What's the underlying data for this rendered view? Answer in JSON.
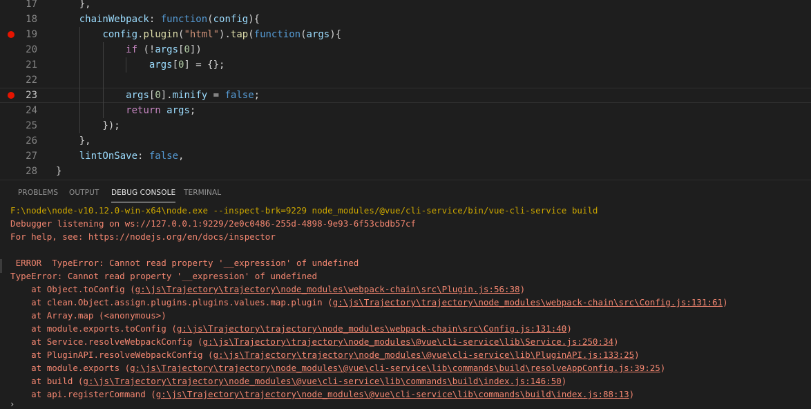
{
  "editor": {
    "lines": [
      {
        "n": "17",
        "code": "    },"
      },
      {
        "n": "18",
        "code": "    chainWebpack: function(config){"
      },
      {
        "n": "19",
        "code": "        config.plugin(\"html\").tap(function(args){",
        "breakpoint": true
      },
      {
        "n": "20",
        "code": "            if (!args[0])"
      },
      {
        "n": "21",
        "code": "                args[0] = {};"
      },
      {
        "n": "22",
        "code": ""
      },
      {
        "n": "23",
        "code": "            args[0].minify = false;",
        "breakpoint": true,
        "current": true
      },
      {
        "n": "24",
        "code": "            return args;"
      },
      {
        "n": "25",
        "code": "        });"
      },
      {
        "n": "26",
        "code": "    },"
      },
      {
        "n": "27",
        "code": "    lintOnSave: false,"
      },
      {
        "n": "28",
        "code": "}"
      }
    ]
  },
  "panel": {
    "tabs": [
      {
        "label": "PROBLEMS",
        "active": false
      },
      {
        "label": "OUTPUT",
        "active": false
      },
      {
        "label": "DEBUG CONSOLE",
        "active": true
      },
      {
        "label": "TERMINAL",
        "active": false
      }
    ],
    "console_lines": [
      {
        "text": "  F:\\node\\node-v10.12.0-win-x64\\node.exe --inspect-brk=9229 node_modules/@vue/cli-service/bin/vue-cli-service build",
        "kind": "cmd"
      },
      {
        "text": "  Debugger listening on ws://127.0.0.1:9229/2e0c0486-255d-4898-9e93-6f53cbdb57cf",
        "kind": "info"
      },
      {
        "text": "  For help, see: https://nodejs.org/en/docs/inspector",
        "kind": "info"
      },
      {
        "text": "",
        "kind": "info"
      },
      {
        "text": "   ERROR  TypeError: Cannot read property '__expression' of undefined",
        "kind": "err"
      },
      {
        "text": "  TypeError: Cannot read property '__expression' of undefined",
        "kind": "err"
      },
      {
        "prefix": "      at Object.toConfig (",
        "path": "g:\\js\\Trajectory\\trajectory\\node_modules\\webpack-chain\\src\\Plugin.js:56:38",
        "suffix": ")",
        "kind": "err"
      },
      {
        "prefix": "      at clean.Object.assign.plugins.plugins.values.map.plugin (",
        "path": "g:\\js\\Trajectory\\trajectory\\node_modules\\webpack-chain\\src\\Config.js:131:61",
        "suffix": ")",
        "kind": "err"
      },
      {
        "text": "      at Array.map (<anonymous>)",
        "kind": "err"
      },
      {
        "prefix": "      at module.exports.toConfig (",
        "path": "g:\\js\\Trajectory\\trajectory\\node_modules\\webpack-chain\\src\\Config.js:131:40",
        "suffix": ")",
        "kind": "err"
      },
      {
        "prefix": "      at Service.resolveWebpackConfig (",
        "path": "g:\\js\\Trajectory\\trajectory\\node_modules\\@vue\\cli-service\\lib\\Service.js:250:34",
        "suffix": ")",
        "kind": "err"
      },
      {
        "prefix": "      at PluginAPI.resolveWebpackConfig (",
        "path": "g:\\js\\Trajectory\\trajectory\\node_modules\\@vue\\cli-service\\lib\\PluginAPI.js:133:25",
        "suffix": ")",
        "kind": "err"
      },
      {
        "prefix": "      at module.exports (",
        "path": "g:\\js\\Trajectory\\trajectory\\node_modules\\@vue\\cli-service\\lib\\commands\\build\\resolveAppConfig.js:39:25",
        "suffix": ")",
        "kind": "err"
      },
      {
        "prefix": "      at build (",
        "path": "g:\\js\\Trajectory\\trajectory\\node_modules\\@vue\\cli-service\\lib\\commands\\build\\index.js:146:50",
        "suffix": ")",
        "kind": "err"
      },
      {
        "prefix": "      at api.registerCommand (",
        "path": "g:\\js\\Trajectory\\trajectory\\node_modules\\@vue\\cli-service\\lib\\commands\\build\\index.js:88:13",
        "suffix": ")",
        "kind": "err"
      }
    ],
    "repl_prompt": "›"
  }
}
